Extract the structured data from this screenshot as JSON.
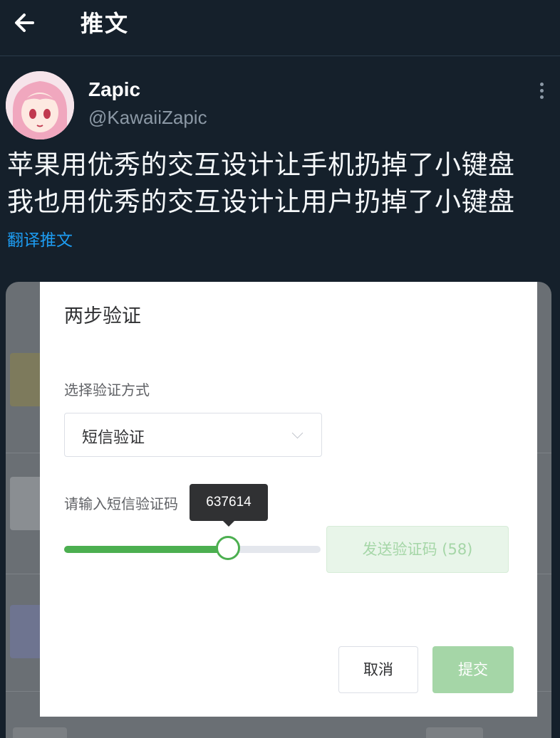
{
  "topbar": {
    "title": "推文"
  },
  "tweet": {
    "name": "Zapic",
    "handle": "@KawaiiZapic",
    "lines": [
      "苹果用优秀的交互设计让手机扔掉了小键盘",
      "我也用优秀的交互设计让用户扔掉了小键盘"
    ],
    "translate_label": "翻译推文"
  },
  "dialog": {
    "title": "两步验证",
    "method_label": "选择验证方式",
    "method_value": "短信验证",
    "code_label": "请输入短信验证码",
    "slider_value_text": "637614",
    "slider_fraction": 0.64,
    "send_button": "发送验证码 (58)",
    "cancel_button": "取消",
    "submit_button": "提交"
  },
  "colors": {
    "background": "#15202b",
    "accent": "#4caf50",
    "link": "#1d9bf0"
  }
}
